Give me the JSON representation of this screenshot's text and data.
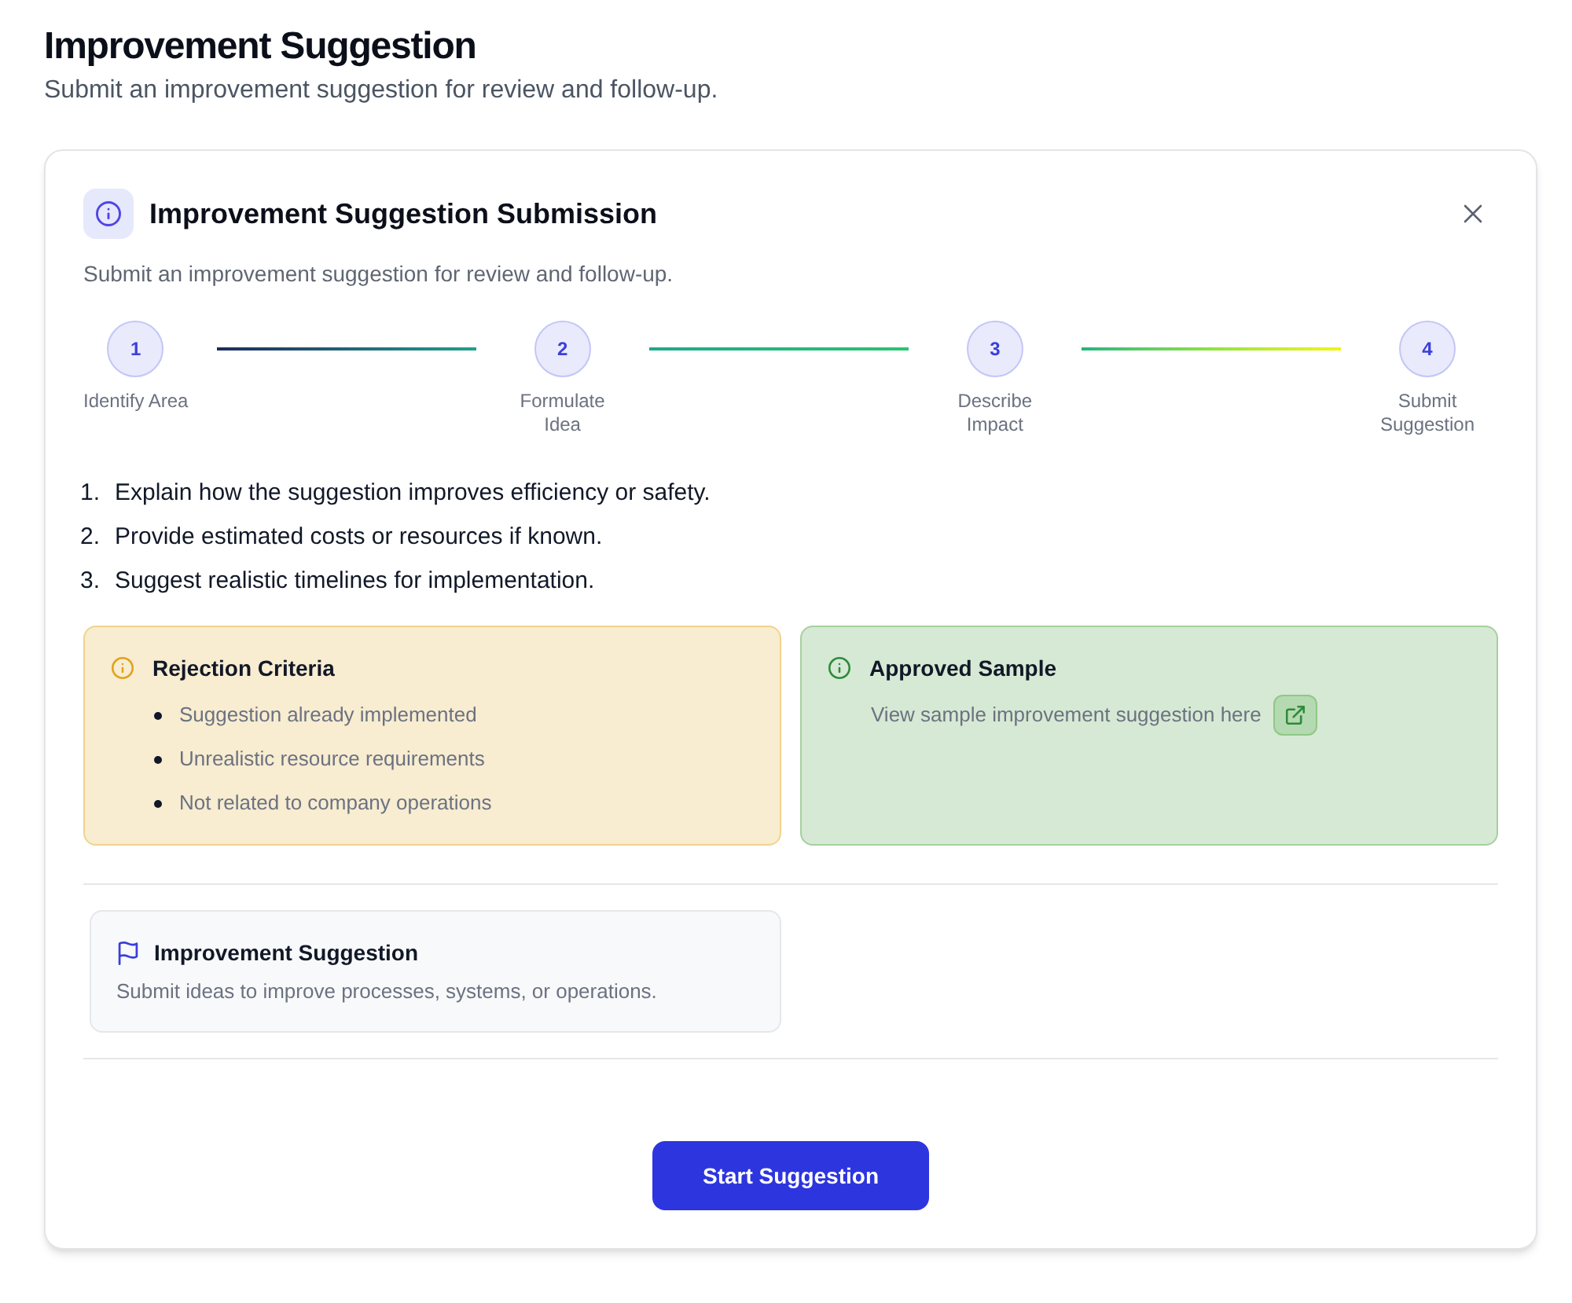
{
  "page": {
    "title": "Improvement Suggestion",
    "subtitle": "Submit an improvement suggestion for review and follow-up."
  },
  "dialog": {
    "title": "Improvement Suggestion Submission",
    "description": "Submit an improvement suggestion for review and follow-up.",
    "steps": [
      {
        "number": "1",
        "label": "Identify Area"
      },
      {
        "number": "2",
        "label": "Formulate Idea"
      },
      {
        "number": "3",
        "label": "Describe Impact"
      },
      {
        "number": "4",
        "label": "Submit Suggestion"
      }
    ],
    "instructions": [
      {
        "number": "1.",
        "text": "Explain how the suggestion improves efficiency or safety."
      },
      {
        "number": "2.",
        "text": "Provide estimated costs or resources if known."
      },
      {
        "number": "3.",
        "text": "Suggest realistic timelines for implementation."
      }
    ],
    "callouts": [
      {
        "kind": "warning",
        "title": "Rejection Criteria",
        "items": [
          "Suggestion already implemented",
          "Unrealistic resource requirements",
          "Not related to company operations"
        ]
      },
      {
        "kind": "success",
        "title": "Approved Sample",
        "text": "View sample improvement suggestion here"
      }
    ],
    "category_card": {
      "title": "Improvement Suggestion",
      "description": "Submit ideas to improve processes, systems, or operations."
    },
    "primary_button": {
      "label": "Start Suggestion"
    }
  }
}
